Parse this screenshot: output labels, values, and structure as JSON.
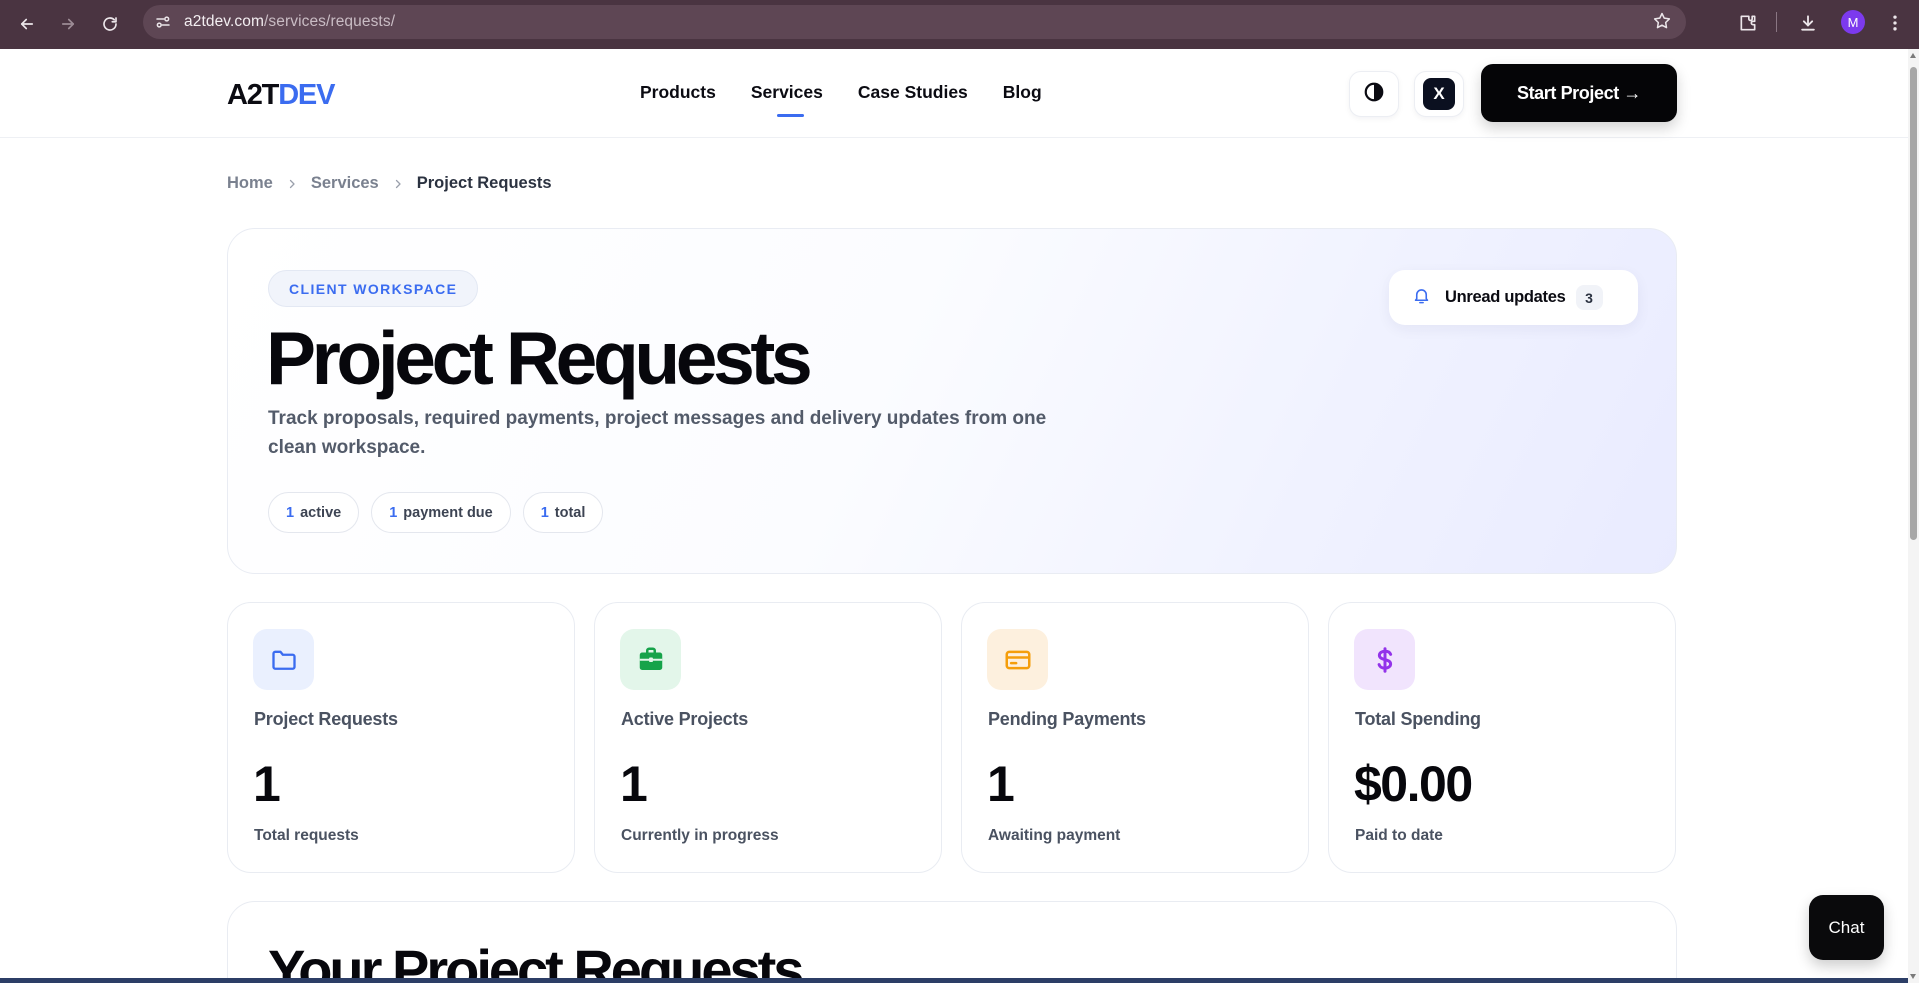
{
  "browser": {
    "url_host": "a2tdev.com",
    "url_path": "/services/requests/",
    "profile_initial": "M"
  },
  "header": {
    "logo_part1": "A2T",
    "logo_part2": "DEV",
    "nav": [
      {
        "label": "Products"
      },
      {
        "label": "Services"
      },
      {
        "label": "Case Studies"
      },
      {
        "label": "Blog"
      }
    ],
    "x_label": "X",
    "cta_label": "Start Project →"
  },
  "breadcrumb": {
    "home": "Home",
    "services": "Services",
    "current": "Project Requests"
  },
  "hero": {
    "tag": "CLIENT WORKSPACE",
    "title": "Project Requests",
    "description": "Track proposals, required payments, project messages and delivery updates from one clean workspace.",
    "pills": [
      {
        "count": "1",
        "label": "active"
      },
      {
        "count": "1",
        "label": "payment due"
      },
      {
        "count": "1",
        "label": "total"
      }
    ],
    "unread_label": "Unread updates",
    "unread_count": "3"
  },
  "cards": [
    {
      "title": "Project Requests",
      "value": "1",
      "sub": "Total requests",
      "icon": "folder-icon",
      "icon_color": "#3b6cf0",
      "icon_bg": "#eaf0fe"
    },
    {
      "title": "Active Projects",
      "value": "1",
      "sub": "Currently in progress",
      "icon": "briefcase-icon",
      "icon_color": "#16a34a",
      "icon_bg": "#e3f6ea"
    },
    {
      "title": "Pending Payments",
      "value": "1",
      "sub": "Awaiting payment",
      "icon": "credit-card-icon",
      "icon_color": "#f59e0b",
      "icon_bg": "#fdf0de"
    },
    {
      "title": "Total Spending",
      "value": "$0.00",
      "sub": "Paid to date",
      "icon": "dollar-icon",
      "icon_color": "#9333ea",
      "icon_bg": "#f1e4fd"
    }
  ],
  "lower": {
    "title": "Your Project Requests"
  },
  "chat": {
    "label": "Chat"
  }
}
